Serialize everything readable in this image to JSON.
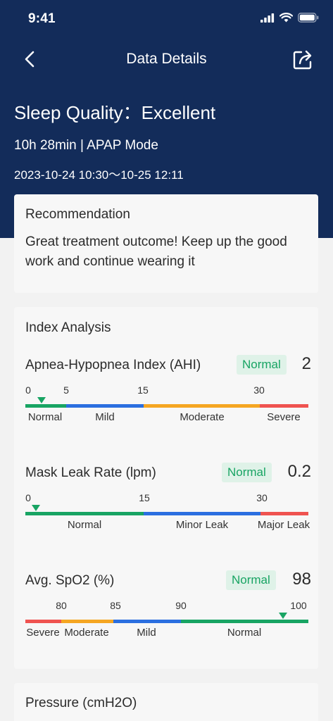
{
  "status": {
    "time": "9:41"
  },
  "nav": {
    "title": "Data Details"
  },
  "summary": {
    "quality": "Sleep Quality：Excellent",
    "duration": "10h 28min | APAP Mode",
    "range": "2023-10-24 10:30～10-25 12:11"
  },
  "recommendation": {
    "title": "Recommendation",
    "text": "Great treatment outcome! Keep up the good work and continue wearing it"
  },
  "index": {
    "title": "Index Analysis",
    "metrics": [
      {
        "name": "Apnea-Hypopnea Index (AHI)",
        "status": "Normal",
        "value": "2",
        "ticks": [
          "0",
          "5",
          "15",
          "30"
        ],
        "labels": [
          "Normal",
          "Mild",
          "Moderate",
          "Severe"
        ],
        "marker_value": 2
      },
      {
        "name": "Mask Leak Rate (lpm)",
        "status": "Normal",
        "value": "0.2",
        "ticks": [
          "0",
          "15",
          "30"
        ],
        "labels": [
          "Normal",
          "Minor Leak",
          "Major Leak"
        ],
        "marker_value": 0.2
      },
      {
        "name": "Avg. SpO2 (%)",
        "status": "Normal",
        "value": "98",
        "ticks": [
          "80",
          "85",
          "90",
          "100"
        ],
        "labels": [
          "Severe",
          "Moderate",
          "Mild",
          "Normal"
        ],
        "marker_value": 98
      }
    ]
  },
  "pressure": {
    "title": "Pressure (cmH2O)"
  },
  "colors": {
    "header_bg": "#132c5a",
    "green": "#18a463",
    "blue": "#2b6fe0",
    "orange": "#f5a623",
    "red": "#ef5350"
  }
}
